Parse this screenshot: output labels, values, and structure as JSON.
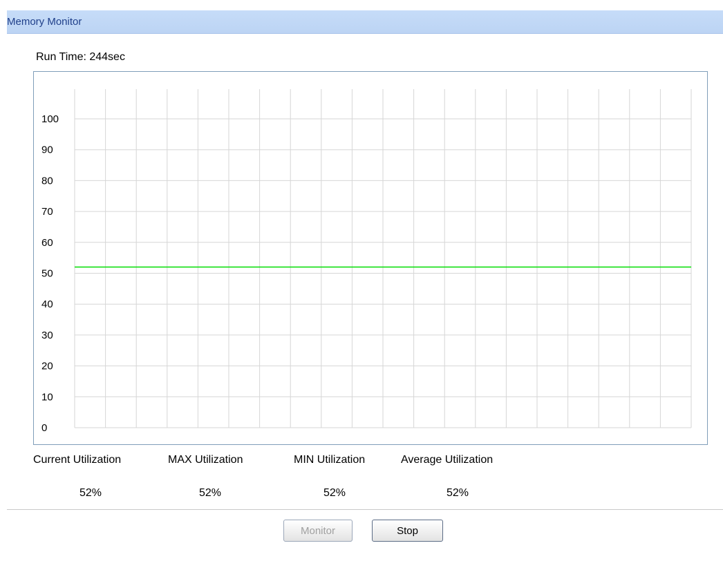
{
  "panel": {
    "title": "Memory Monitor"
  },
  "run_time": {
    "text": "Run Time: 244sec"
  },
  "chart_data": {
    "type": "line",
    "title": "",
    "xlabel": "",
    "ylabel": "",
    "ylim": [
      0,
      100
    ],
    "ytick_labels": [
      "100",
      "90",
      "80",
      "70",
      "60",
      "50",
      "40",
      "30",
      "20",
      "10",
      "0"
    ],
    "grid": true,
    "x_gridlines": 20,
    "series": [
      {
        "values": [
          52,
          52
        ],
        "color": "#00dd00"
      }
    ]
  },
  "stats": [
    {
      "label": "Current Utilization",
      "value": "52%"
    },
    {
      "label": "MAX Utilization",
      "value": "52%"
    },
    {
      "label": "MIN Utilization",
      "value": "52%"
    },
    {
      "label": "Average Utilization",
      "value": "52%"
    }
  ],
  "buttons": {
    "monitor_label": "Monitor",
    "stop_label": "Stop"
  },
  "colors": {
    "header_bg": "#c6dcf8",
    "header_text": "#1f3f8a",
    "chart_border": "#7f9db9",
    "grid": "#d6d6d6",
    "series_line": "#00dd00"
  }
}
